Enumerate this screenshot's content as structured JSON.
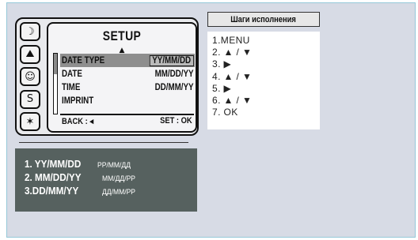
{
  "camera_icons": [
    {
      "name": "night-portrait-icon",
      "glyph": "☽"
    },
    {
      "name": "landscape-icon",
      "glyph": "⛰"
    },
    {
      "name": "portrait-icon",
      "glyph": "☺"
    },
    {
      "name": "sport-icon",
      "glyph": "S"
    },
    {
      "name": "fireworks-icon",
      "glyph": "✶"
    }
  ],
  "setup_screen": {
    "title": "SETUP",
    "scroll_up_arrow": "▲",
    "rows": [
      {
        "label": "DATE TYPE",
        "value": "YY/MM/DD",
        "selected": true
      },
      {
        "label": "DATE",
        "value": "MM/DD/YY",
        "selected": false
      },
      {
        "label": "TIME",
        "value": "DD/MM/YY",
        "selected": false
      },
      {
        "label": "IMPRINT",
        "value": "",
        "selected": false
      }
    ],
    "back_label": "BACK : ◂",
    "set_label": "SET : OK"
  },
  "formats": [
    {
      "main": "1. YY/MM/DD",
      "sub": "РР/ММ/ДД"
    },
    {
      "main": "2. MM/DD/YY",
      "sub": "ММ/ДД/РР"
    },
    {
      "main": "3.DD/MM/YY",
      "sub": "ДД/ММ/РР"
    }
  ],
  "steps": {
    "title": "Шаги исполнения",
    "items": [
      "1.MENU",
      "2. ▲ / ▼",
      "3. ▶",
      "4. ▲ / ▼",
      "5. ▶",
      "6. ▲ / ▼",
      "7. OK"
    ]
  },
  "colors": {
    "background": "#d7dbe5",
    "frame_border": "#95c8d8",
    "format_panel": "#56615f",
    "selected_row": "#8e8e8e"
  }
}
